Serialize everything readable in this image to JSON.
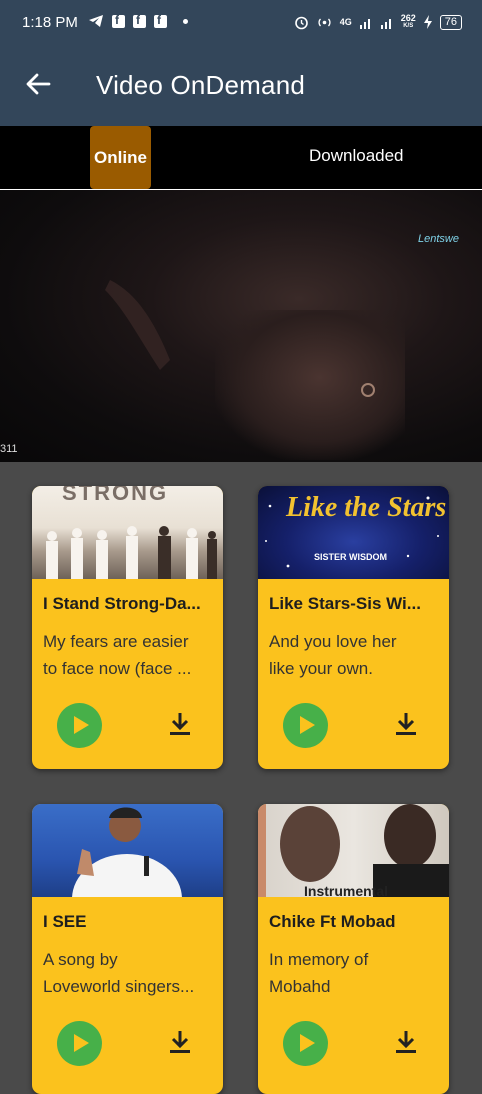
{
  "status": {
    "time": "1:18 PM",
    "net_label": "4G",
    "speed": "262",
    "speed_unit": "K/S",
    "battery": "76"
  },
  "appbar": {
    "title": "Video OnDemand"
  },
  "tabs": {
    "online": "Online",
    "downloaded": "Downloaded"
  },
  "video": {
    "logo": "Lentswe",
    "counter": "311"
  },
  "cards": [
    {
      "title": "I Stand Strong-Da...",
      "line1": "My fears are easier",
      "line2": "to face now (face ...",
      "thumb_text": "STRONG"
    },
    {
      "title": "Like Stars-Sis Wi...",
      "line1": "And you love her",
      "line2": "like your own.",
      "thumb_text": "Like the Stars",
      "thumb_sub": "SISTER WISDOM"
    },
    {
      "title": "I SEE",
      "line1": "A song by",
      "line2": "Loveworld singers..."
    },
    {
      "title": "Chike Ft Mobad",
      "line1": "In memory of",
      "line2": "Mobahd",
      "thumb_text": "Instrumental"
    }
  ],
  "colors": {
    "appbar": "#33465a",
    "tab_active": "#9a5b00",
    "card": "#fbc21d",
    "play": "#47b049"
  }
}
